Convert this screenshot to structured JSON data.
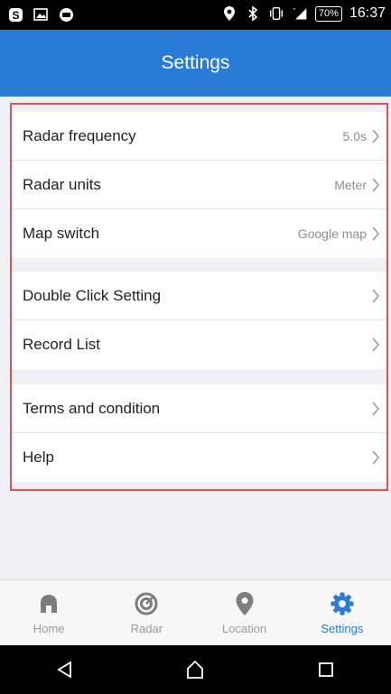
{
  "status_bar": {
    "battery": "70%",
    "time": "16:37",
    "icons": [
      "skype-icon",
      "image-icon",
      "chat-icon",
      "location-icon",
      "bluetooth-icon",
      "vibrate-icon",
      "signal-icon"
    ]
  },
  "header": {
    "title": "Settings"
  },
  "groups": [
    {
      "rows": [
        {
          "label": "Radar frequency",
          "value": "5.0s"
        },
        {
          "label": "Radar units",
          "value": "Meter"
        },
        {
          "label": "Map switch",
          "value": "Google map"
        }
      ]
    },
    {
      "rows": [
        {
          "label": "Double Click Setting",
          "value": ""
        },
        {
          "label": "Record List",
          "value": ""
        }
      ]
    },
    {
      "rows": [
        {
          "label": "Terms and condition",
          "value": ""
        },
        {
          "label": "Help",
          "value": ""
        }
      ]
    }
  ],
  "tabs": [
    {
      "label": "Home",
      "icon": "home-icon",
      "active": false
    },
    {
      "label": "Radar",
      "icon": "radar-icon",
      "active": false
    },
    {
      "label": "Location",
      "icon": "location-pin-icon",
      "active": false
    },
    {
      "label": "Settings",
      "icon": "gear-icon",
      "active": true
    }
  ],
  "colors": {
    "accent": "#2a7bd6",
    "highlight": "#e0524f",
    "tab_inactive": "#9a9a9a"
  }
}
